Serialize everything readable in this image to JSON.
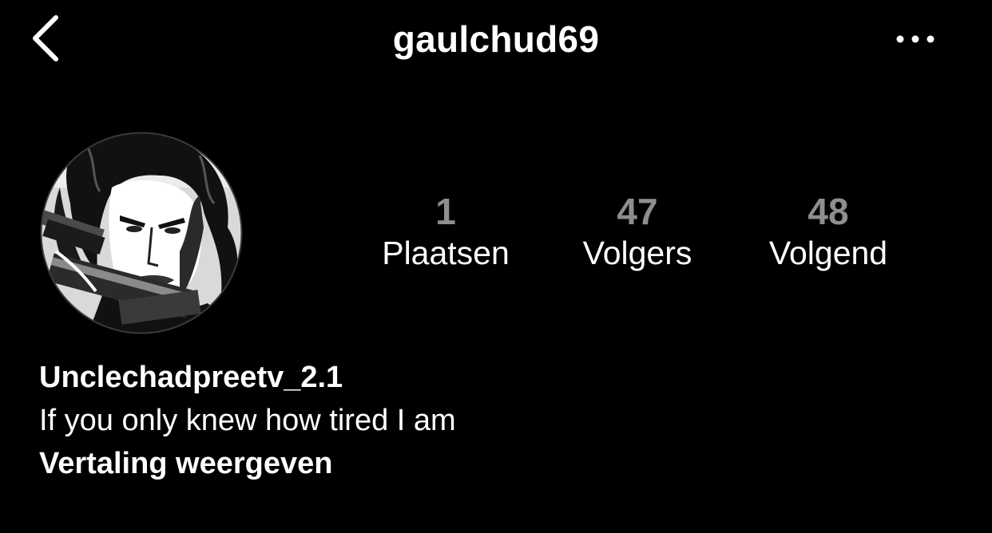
{
  "header": {
    "username": "gaulchud69",
    "back_icon": "chevron-left-icon",
    "more_icon": "more-horizontal-icon"
  },
  "profile": {
    "avatar_icon": "profile-avatar",
    "stats": [
      {
        "value": "1",
        "label": "Plaatsen"
      },
      {
        "value": "47",
        "label": "Volgers"
      },
      {
        "value": "48",
        "label": "Volgend"
      }
    ],
    "display_name": "Unclechadpreetv_2.1",
    "bio": "If you only knew how tired I am",
    "translate_label": "Vertaling weergeven"
  },
  "colors": {
    "background": "#000000",
    "text": "#ffffff",
    "stat_number": "#8e8e8e"
  }
}
